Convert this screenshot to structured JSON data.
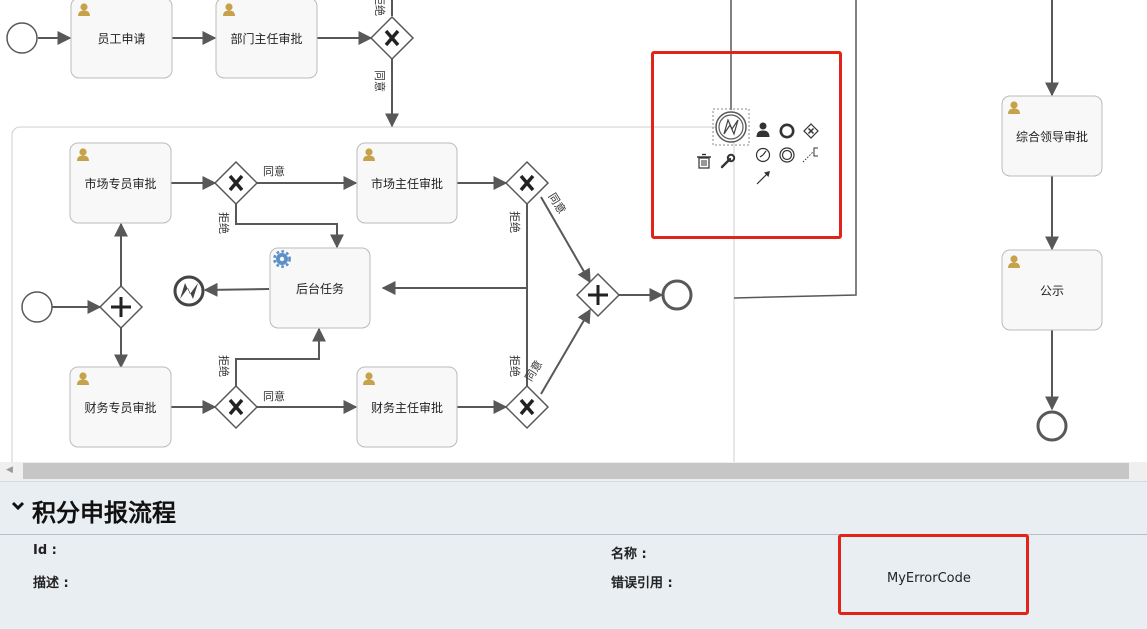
{
  "diagram": {
    "tasks": {
      "employee_apply": "员工申请",
      "dept_head_approve": "部门主任审批",
      "market_specialist_approve": "市场专员审批",
      "market_head_approve": "市场主任审批",
      "backend_task": "后台任务",
      "finance_specialist_approve": "财务专员审批",
      "finance_head_approve": "财务主任审批",
      "leadership_approve": "综合领导审批",
      "announce": "公示"
    },
    "flow_labels": {
      "agree": "同意",
      "reject": "拒绝"
    },
    "palette_tools": [
      "user-task-icon",
      "end-event-icon",
      "exclusive-gateway-icon",
      "delete-icon",
      "wrench-icon",
      "timer-event-icon",
      "intermediate-event-icon",
      "annotation-icon",
      "connection-arrow-icon"
    ]
  },
  "properties": {
    "title": "积分申报流程",
    "id_label": "Id :",
    "name_label": "名称 :",
    "desc_label": "描述 :",
    "error_ref_label": "错误引用 :",
    "error_ref_value": "MyErrorCode"
  },
  "colors": {
    "highlight": "#e2231a",
    "user_icon": "#c8a24a",
    "service_icon": "#5b8fc7",
    "panel_bg": "#e9eef2"
  }
}
